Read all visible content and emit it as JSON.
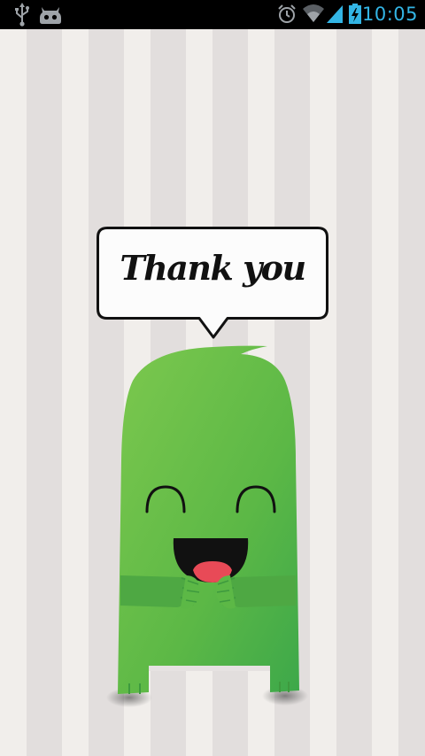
{
  "status_bar": {
    "time": "10:05",
    "icons": [
      "usb-icon",
      "cyanogen-mascot-icon",
      "alarm-icon",
      "wifi-icon",
      "signal-icon",
      "battery-charging-icon"
    ],
    "accent_color": "#33b5e5"
  },
  "speech_bubble": {
    "text": "Thank you"
  },
  "monster": {
    "body_color": "#5cb846",
    "mouth_color": "#111111",
    "tongue_color": "#e84a57"
  },
  "background": {
    "stripe_light": "#f1eeeb",
    "stripe_dark": "#e2dedd"
  }
}
